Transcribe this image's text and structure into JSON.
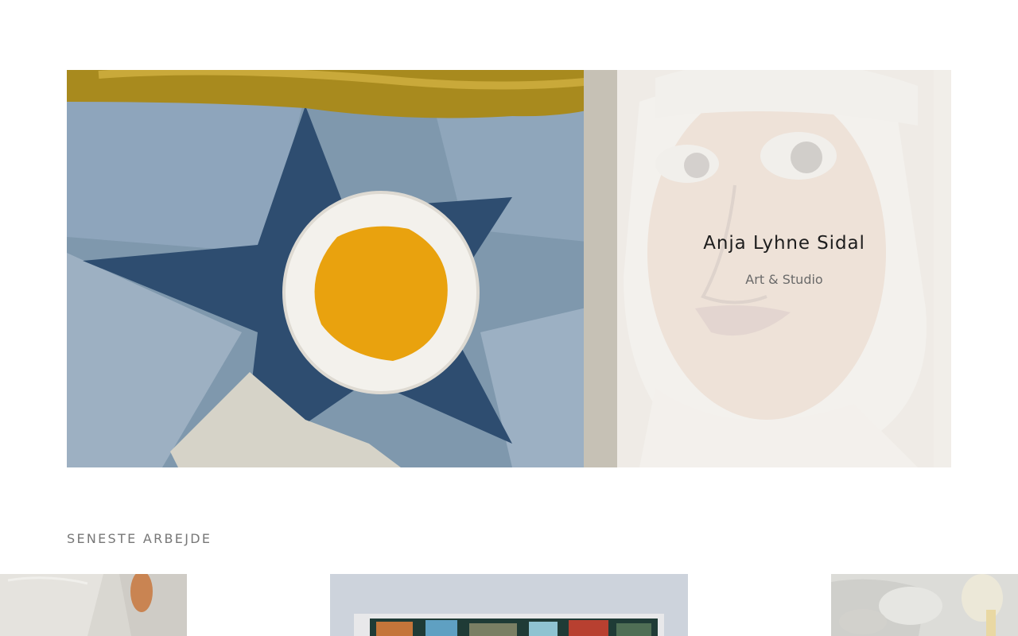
{
  "hero": {
    "artist_name": "Anja Lyhne Sidal",
    "subtitle": "Art & Studio",
    "artwork_icon": "painting-aviator-star"
  },
  "latest_work": {
    "heading": "SENESTE ARBEJDE",
    "items": [
      {
        "icon": "painting-thumbnail-light"
      },
      {
        "icon": "painting-thumbnail-framed"
      },
      {
        "icon": "painting-thumbnail-pale"
      }
    ]
  },
  "colors": {
    "overlay": "#f2f0ec",
    "title": "#1d1d1d",
    "subtitle": "#6a6a6a",
    "heading": "#777777",
    "star_blue": "#2e4d70",
    "sun_orange": "#e9a20e"
  }
}
